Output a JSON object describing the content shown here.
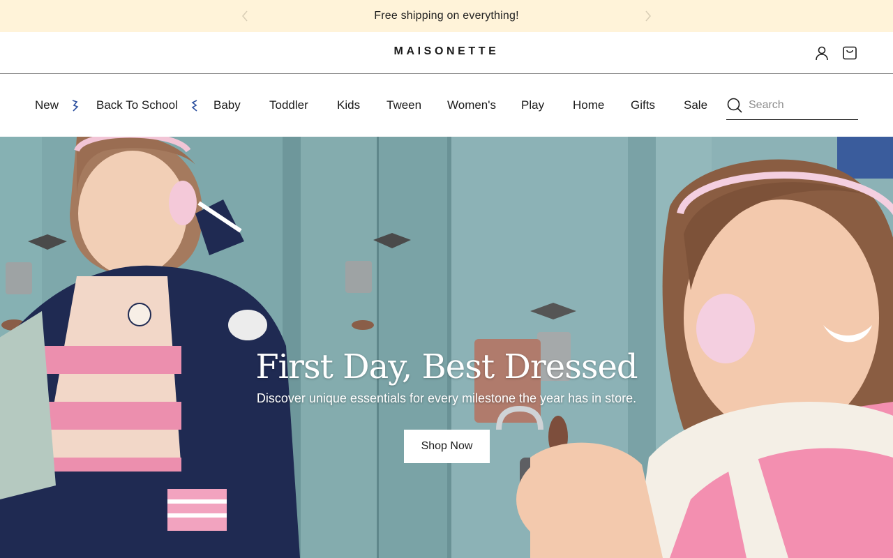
{
  "announcement": {
    "text": "Free shipping on everything!"
  },
  "header": {
    "logo": "MAISONETTE",
    "icons": [
      "account-icon",
      "cart-icon"
    ]
  },
  "nav": {
    "items": [
      {
        "label": "New"
      },
      {
        "label": "Back To School"
      },
      {
        "label": "Baby"
      },
      {
        "label": "Toddler"
      },
      {
        "label": "Kids"
      },
      {
        "label": "Tween"
      },
      {
        "label": "Women's"
      },
      {
        "label": "Play"
      },
      {
        "label": "Home"
      },
      {
        "label": "Gifts"
      },
      {
        "label": "Sale"
      }
    ],
    "search_placeholder": "Search"
  },
  "hero": {
    "title": "First Day, Best Dressed",
    "subtitle": "Discover unique essentials for every milestone the year has in store.",
    "cta": "Shop Now"
  },
  "colors": {
    "announcement_bg": "#fff3d9",
    "nav_accent": "#2b4f9e",
    "locker_teal": "#7fa9ad"
  }
}
